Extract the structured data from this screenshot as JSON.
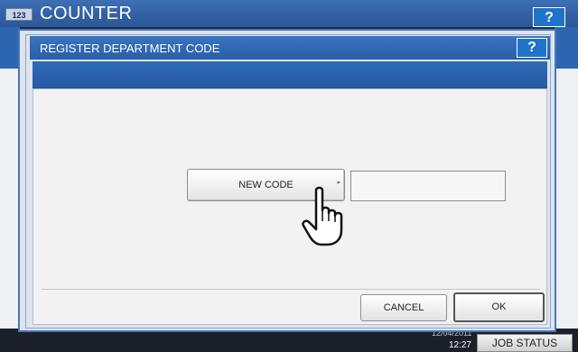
{
  "background_window": {
    "icon_label": "123",
    "title": "COUNTER",
    "help_label": "?"
  },
  "dialog": {
    "title": "REGISTER DEPARTMENT CODE",
    "help_label": "?",
    "new_code_label": "NEW CODE",
    "code_value": "",
    "cancel_label": "CANCEL",
    "ok_label": "OK"
  },
  "statusbar": {
    "date": "12/04/2011",
    "time": "12:27",
    "job_status_label": "JOB STATUS"
  },
  "icons": {
    "pointer": "hand-pointer-icon",
    "submenu": "submenu-arrow-icon"
  },
  "colors": {
    "title_blue": "#2a5fa8",
    "help_blue": "#1f73c9"
  }
}
